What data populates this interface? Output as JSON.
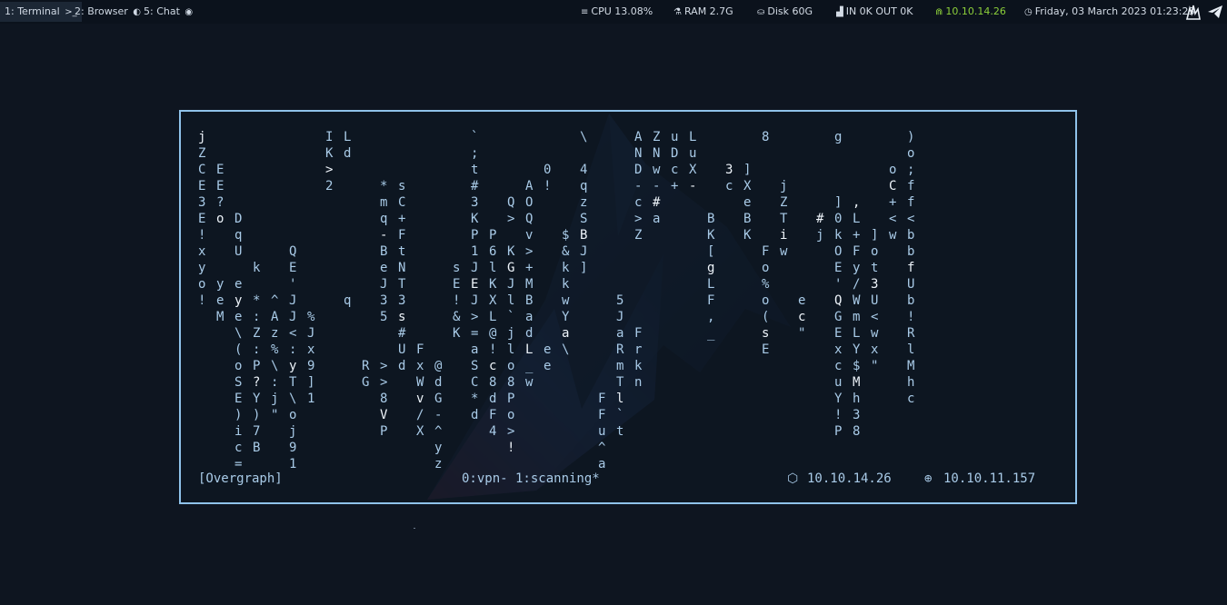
{
  "workspaces": [
    {
      "label": "1: Terminal",
      "glyph": ">_",
      "active": true
    },
    {
      "label": "2: Browser",
      "glyph": "◐",
      "active": false
    },
    {
      "label": "5: Chat",
      "glyph": "◉",
      "active": false
    }
  ],
  "status": {
    "cpu": "CPU 13.08%",
    "ram": "RAM 2.7G",
    "disk": "Disk 60G",
    "net": "IN 0K OUT 0K",
    "vpn_ip": "10.10.14.26",
    "datetime": "Friday, 03 March 2023 01:23:23"
  },
  "icons": {
    "cpu": "≡",
    "ram": "⚗",
    "disk": "⛀",
    "net": "▟",
    "vpn": "⋒",
    "clock": "◷",
    "tray1": "flame-icon",
    "tray2": "telegram-icon"
  },
  "colors": {
    "background": "#0e1520",
    "topbar": "#0b121c",
    "terminal_border": "#8fc2ea",
    "terminal_text": "#a9cbe8",
    "vpn_green": "#8ccf3a"
  },
  "tmux": {
    "session": "[Overgraph]",
    "windows": "0:vpn- 1:scanning*",
    "local_ip_icon": "⬡",
    "local_ip": "10.10.14.26",
    "target_ip_icon": "⊕",
    "target_ip": "10.10.11.157"
  },
  "matrix_columns": [
    "jZCE3E!xyo!",
    "  EE?o   yeM",
    "     DqU eye\\(oSE)ic=",
    "        k *:Z:P?Y)7B",
    "          ^Az%\\:j\"",
    "       QE'JJ<:yT\\oj91n",
    "           %Jx9]1",
    "IK>2",
    "Ld        q",
    "              RG",
    "   *mq-BeJ35  >>8VP",
    "   sC+FtNT3s#Ud",
    "             FxWv/X",
    "              @dG-^yz=",
    "        sE!&K",
    "`;t#3KP1JEJ>=aSC*d",
    "      P6lKXL@!c8dF4",
    "    Q> KGJl`jlo8Po>!",
    "   AOQv>+MBadL_w",
    "  0!         ee",
    "      $&kkwYa\\",
    "\\ 4qzSBJ]",
    "                FFu^a",
    "          5JaRmTl`t",
    "AND-c>Z     Frkn",
    "ZNw-#a",
    "uDc+",
    "LuX-",
    "     BK[gLF,_",
    "  3c",
    "  ]XeBK",
    "8      Fo%o(sE",
    "   jZTiw",
    "          ec\"",
    "     #j",
    "g   ]0kOE'QGExcuY!P",
    "    ,L+Fy/WmLY$Mh38",
    "      ]ot3U<wx\"",
    "  oC+<w",
    ")o;ff<bbfUb!RlMhc"
  ]
}
